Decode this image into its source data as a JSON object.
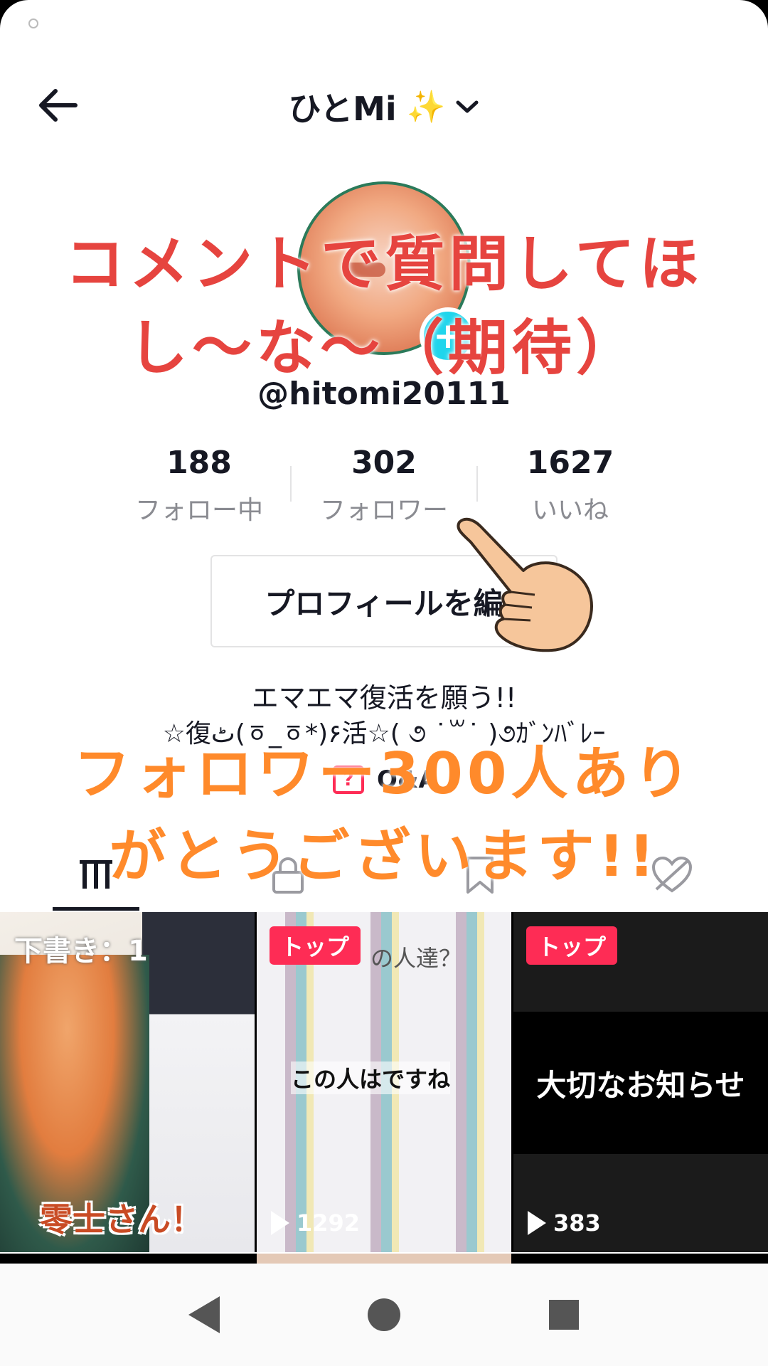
{
  "header": {
    "title": "ひとMi",
    "title_emoji": "✨",
    "back_icon": "arrow-left-icon",
    "dropdown_icon": "chevron-down-icon"
  },
  "profile": {
    "username": "@hitomi20111",
    "add_icon": "plus-icon",
    "add_symbol": "+",
    "stats": {
      "following": {
        "value": "188",
        "label": "フォロー中"
      },
      "followers": {
        "value": "302",
        "label": "フォロワー"
      },
      "likes": {
        "value": "1627",
        "label": "いいね"
      }
    },
    "edit_button": "プロフィールを編",
    "bio_line1": "エマエマ復活を願う!!",
    "bio_line2": "☆復ٹ(ㆆ_ㆆ*)۶活☆( ૭ ˙꒳˙ )૭ｶﾞﾝﾊﾞﾚｰ",
    "qa_label": "Q&A",
    "qa_icon_symbol": "?"
  },
  "overlays": {
    "caption_top_line1": "コメントで質問してほ",
    "caption_top_line2": "し〜な〜（期待）",
    "caption_bottom_line1": "フォロワー300人あり",
    "caption_bottom_line2": "がとうございます!!"
  },
  "tabs": [
    {
      "icon": "videos-grid-icon"
    },
    {
      "icon": "lock-icon"
    },
    {
      "icon": "bookmark-icon"
    },
    {
      "icon": "liked-hidden-icon"
    }
  ],
  "videos": [
    {
      "label": "下書き：1",
      "caption": "零士さん！"
    },
    {
      "badge": "トップ",
      "views": "1292",
      "text_top": "の人達？",
      "text_mid": "この人はですね"
    },
    {
      "badge": "トップ",
      "views": "383",
      "text_mid": "大切なお知らせ"
    }
  ],
  "navbar": {
    "back": "nav-back-icon",
    "home": "nav-home-icon",
    "recents": "nav-recents-icon"
  },
  "colors": {
    "accent": "#fe2c55",
    "avatar_add": "#20d5ec",
    "overlay_red": "#e6443f",
    "overlay_orange": "#ff8a2b"
  }
}
